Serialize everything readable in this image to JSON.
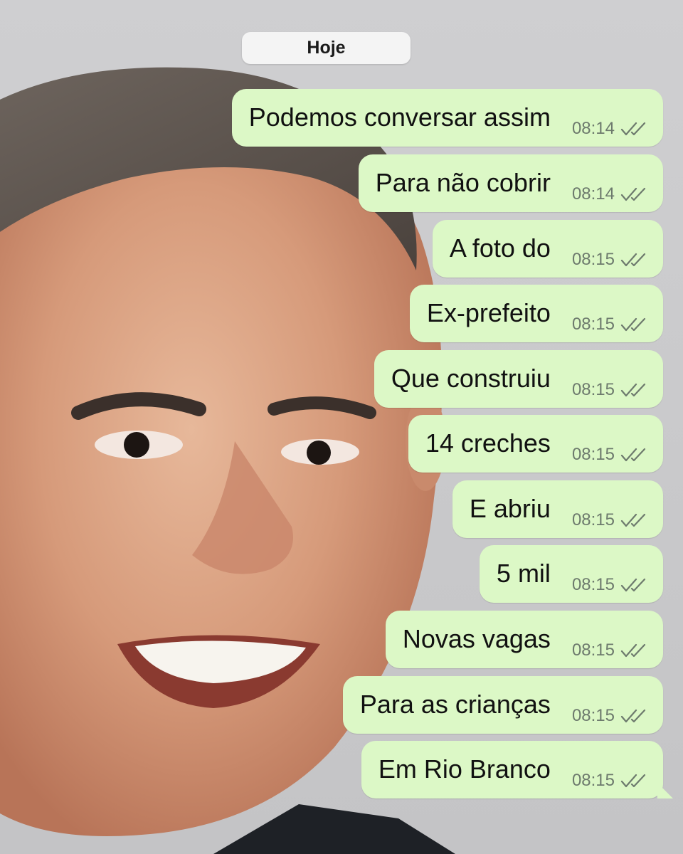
{
  "date_label": "Hoje",
  "accent_colors": {
    "bubble": "#dcf8c6",
    "ticks": "#6d7a6d"
  },
  "messages": [
    {
      "text": "Podemos conversar assim",
      "time": "08:14",
      "status_icon": "double-check-icon"
    },
    {
      "text": "Para não cobrir",
      "time": "08:14",
      "status_icon": "double-check-icon"
    },
    {
      "text": "A foto do",
      "time": "08:15",
      "status_icon": "double-check-icon"
    },
    {
      "text": "Ex-prefeito",
      "time": "08:15",
      "status_icon": "double-check-icon"
    },
    {
      "text": "Que construiu",
      "time": "08:15",
      "status_icon": "double-check-icon"
    },
    {
      "text": "14 creches",
      "time": "08:15",
      "status_icon": "double-check-icon"
    },
    {
      "text": "E abriu",
      "time": "08:15",
      "status_icon": "double-check-icon"
    },
    {
      "text": "5 mil",
      "time": "08:15",
      "status_icon": "double-check-icon"
    },
    {
      "text": "Novas vagas",
      "time": "08:15",
      "status_icon": "double-check-icon"
    },
    {
      "text": "Para as crianças",
      "time": "08:15",
      "status_icon": "double-check-icon"
    },
    {
      "text": "Em Rio Branco",
      "time": "08:15",
      "status_icon": "double-check-icon"
    }
  ]
}
